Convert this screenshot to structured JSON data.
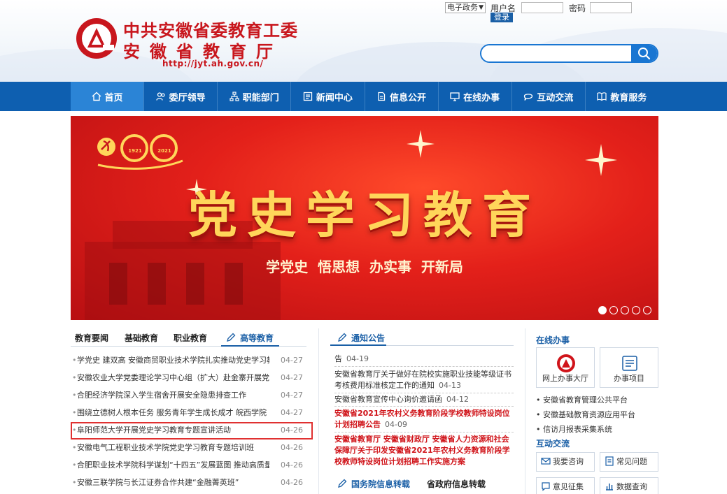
{
  "header": {
    "title_line1": "中共安徽省委教育工委",
    "title_line2": "安徽省教育厅",
    "url": "http://jyt.ah.gov.cn/",
    "gov_select": "电子政务",
    "username_label": "用户名",
    "password_label": "密码",
    "login_label": "登录",
    "brand_color": "#c8161d",
    "accent_color": "#0e5fb0"
  },
  "nav": {
    "items": [
      {
        "label": "首页",
        "icon": "home-icon"
      },
      {
        "label": "委厅领导",
        "icon": "people-icon"
      },
      {
        "label": "职能部门",
        "icon": "org-icon"
      },
      {
        "label": "新闻中心",
        "icon": "news-icon"
      },
      {
        "label": "信息公开",
        "icon": "document-icon"
      },
      {
        "label": "在线办事",
        "icon": "monitor-icon"
      },
      {
        "label": "互动交流",
        "icon": "chat-icon"
      },
      {
        "label": "教育服务",
        "icon": "book-icon"
      }
    ]
  },
  "banner": {
    "title": "党史学习教育",
    "subtitle": "学党史  悟思想  办实事  开新局",
    "year_left": "1921",
    "year_right": "2021",
    "anniversary": "100"
  },
  "news": {
    "tabs": [
      "教育要闻",
      "基础教育",
      "职业教育",
      "高等教育"
    ],
    "items": [
      {
        "title": "学党史 建双高 安徽商贸职业技术学院扎实推动党史学习教育",
        "date": "04-27"
      },
      {
        "title": "安徽农业大学党委理论学习中心组（扩大）赴金寨开展党史学习",
        "date": "04-27"
      },
      {
        "title": "合肥经济学院深入学生宿舍开展安全隐患排查工作",
        "date": "04-27"
      },
      {
        "title": "围绕立德树人根本任务 服务青年学生成长成才 皖西学院",
        "date": "04-27"
      },
      {
        "title": "阜阳师范大学开展党史学习教育专题宣讲活动",
        "date": "04-26"
      },
      {
        "title": "安徽电气工程职业技术学院党史学习教育专题培训班",
        "date": "04-26"
      },
      {
        "title": "合肥职业技术学院科学谋划“十四五”发展蓝图 推动高质量发展",
        "date": "04-26"
      },
      {
        "title": "安徽三联学院与长江证券合作共建“金融菁英班”",
        "date": "04-26"
      }
    ]
  },
  "notices": {
    "heading": "通知公告",
    "items": [
      {
        "title": "告",
        "date": "04-19",
        "red": false
      },
      {
        "title": "安徽省教育厅关于做好在院校实施职业技能等级证书考核费用标准核定工作的通知",
        "date": "04-13",
        "red": false
      },
      {
        "title": "安徽省教育宣传中心询价邀请函",
        "date": "04-12",
        "red": false
      },
      {
        "title": "安徽省2021年农村义务教育阶段学校教师特设岗位计划招聘公告",
        "date": "04-09",
        "red": true
      },
      {
        "title": "安徽省教育厅 安徽省财政厅 安徽省人力资源和社会保障厅关于印发安徽省2021年农村义务教育阶段学校教师特设岗位计划招聘工作实施方案",
        "date": "",
        "red": true
      }
    ],
    "bottom_tabs": [
      "国务院信息转载",
      "省政府信息转载"
    ]
  },
  "services": {
    "online_heading": "在线办事",
    "boxes": [
      {
        "label": "网上办事大厅",
        "icon": "service-hall-icon"
      },
      {
        "label": "办事项目",
        "icon": "list-icon"
      }
    ],
    "links": [
      "安徽省教育管理公共平台",
      "安徽基础教育资源应用平台",
      "信访月报表采集系统"
    ],
    "interact_heading": "互动交流",
    "interact": [
      {
        "label": "我要咨询",
        "icon": "mail-icon"
      },
      {
        "label": "常见问题",
        "icon": "faq-icon"
      },
      {
        "label": "意见征集",
        "icon": "feedback-icon"
      },
      {
        "label": "数据查询",
        "icon": "data-icon"
      }
    ]
  }
}
